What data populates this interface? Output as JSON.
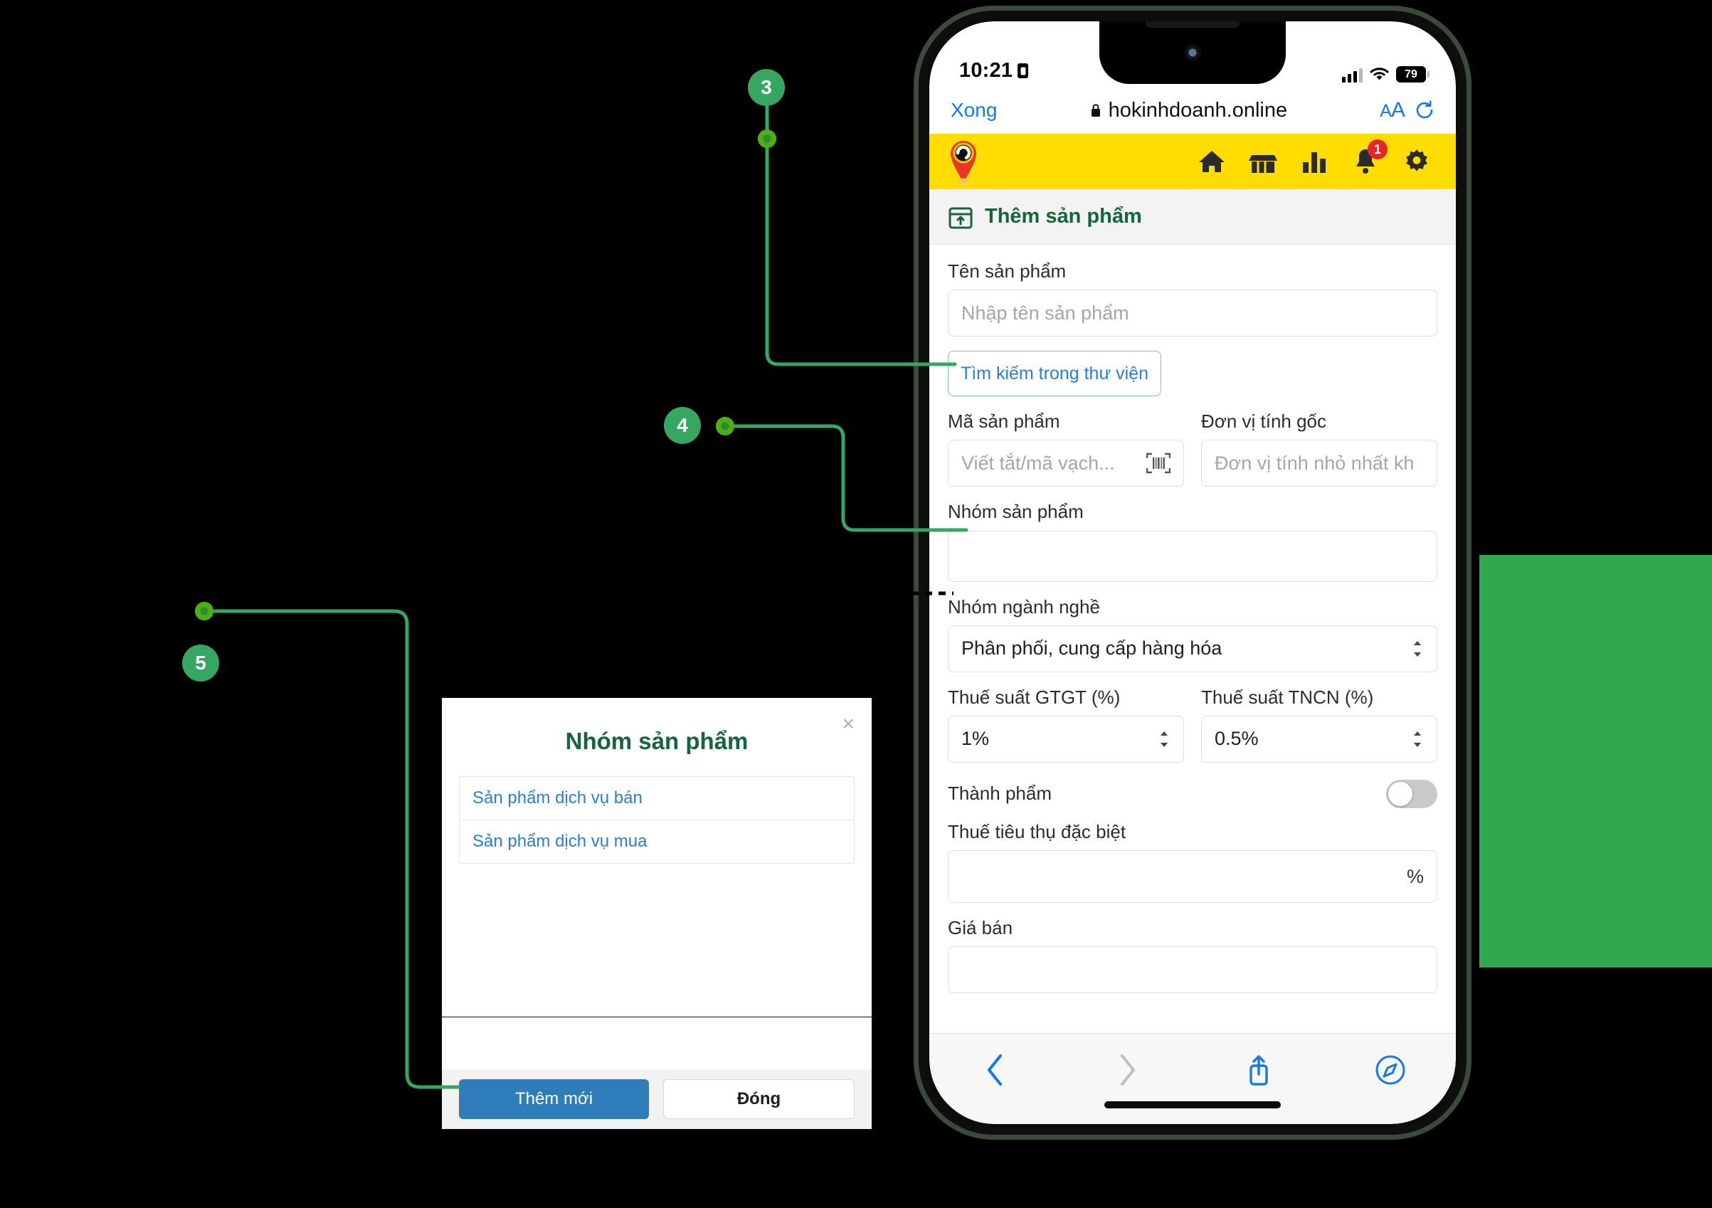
{
  "statusbar": {
    "time": "10:21",
    "battery": "79"
  },
  "browser": {
    "done_label": "Xong",
    "url": "hokinhdoanh.online",
    "text_size_label": "AA"
  },
  "appbar": {
    "notification_count": "1",
    "icons": [
      "home-icon",
      "store-icon",
      "chart-icon",
      "bell-icon",
      "gear-icon"
    ],
    "background": "#FFDD00"
  },
  "page": {
    "title": "Thêm sản phẩm",
    "title_color": "#14653a"
  },
  "form": {
    "product_name_label": "Tên sản phẩm",
    "product_name_placeholder": "Nhập tên sản phẩm",
    "library_search_button": "Tìm kiếm trong thư viện",
    "product_code_label": "Mã sản phẩm",
    "product_code_placeholder": "Viết tắt/mã vạch...",
    "base_unit_label": "Đơn vị tính gốc",
    "base_unit_placeholder": "Đơn vị tính nhỏ nhất kh",
    "product_group_label": "Nhóm sản phẩm",
    "product_group_value": "",
    "industry_group_label": "Nhóm ngành nghề",
    "industry_group_value": "Phân phối, cung cấp hàng hóa",
    "vat_label": "Thuế suất GTGT (%)",
    "vat_value": "1%",
    "pit_label": "Thuế suất TNCN (%)",
    "pit_value": "0.5%",
    "finished_product_label": "Thành phẩm",
    "finished_product_on": false,
    "excise_tax_label": "Thuế tiêu thụ đặc biệt",
    "excise_tax_value": "",
    "excise_tax_suffix": "%",
    "sale_price_label": "Giá bán"
  },
  "modal": {
    "title": "Nhóm sản phẩm",
    "close_label": "×",
    "items": [
      {
        "label": "Sản phẩm dịch vụ bán"
      },
      {
        "label": "Sản phẩm dịch vụ mua"
      }
    ],
    "primary_button": "Thêm mới",
    "secondary_button": "Đóng",
    "primary_color": "#2f7cbb"
  },
  "callouts": [
    {
      "number": "3"
    },
    {
      "number": "4"
    },
    {
      "number": "5"
    }
  ],
  "theme": {
    "marker_green": "#35A763",
    "line_green": "#35A763",
    "dot_green": "#4CAF14",
    "block_green": "#2FA84F"
  }
}
